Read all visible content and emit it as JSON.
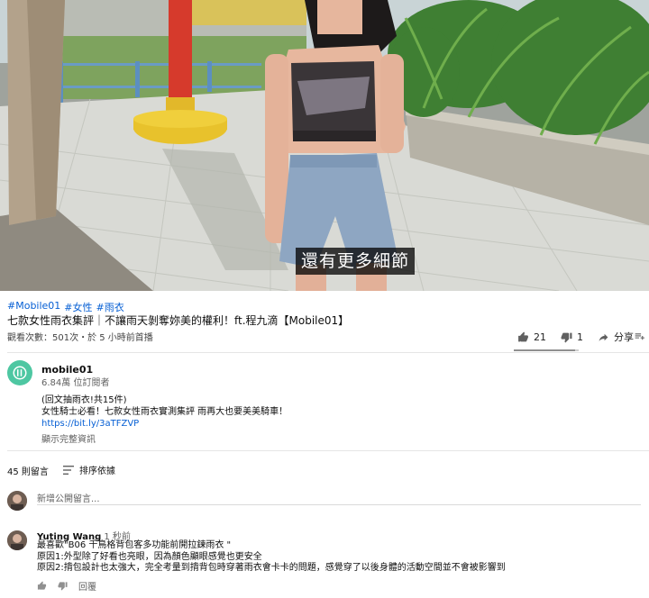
{
  "video": {
    "subtitle": "還有更多細節"
  },
  "hashtags": [
    "#Mobile01",
    "#女性",
    "#雨衣"
  ],
  "title": "七款女性雨衣集評｜不讓雨天剝奪妳美的權利！ft.程九滴【Mobile01】",
  "views": "觀看次數：501次・於 5 小時前首播",
  "actions": {
    "like_count": "21",
    "dislike_count": "1",
    "share_label": "分享"
  },
  "ratio": {
    "like_fraction": 0.94
  },
  "channel": {
    "name": "mobile01",
    "subscribers": "6.84萬 位訂閱者",
    "desc_line1": "(回文抽雨衣!共15件)",
    "desc_line2": "女性騎士必看！七款女性雨衣實測集評 雨再大也要美美騎車！",
    "desc_link": "https://bit.ly/3aTFZVP",
    "show_more": "顯示完整資訊"
  },
  "comments": {
    "count": "45 則留言",
    "sort_label": "排序依據",
    "add_placeholder": "新增公開留言...",
    "items": [
      {
        "author": "Yuting Wang",
        "time": "1 秒前",
        "line1": "最喜歡\"B06 千鳥格背包客多功能前開拉鍊雨衣 \"",
        "line2": "原因1:外型除了好看也亮眼，因為顏色顯眼感覺也更安全",
        "line3": "原因2:揹包設計也太強大，完全考量到揹背包時穿著雨衣會卡卡的問題，感覺穿了以後身體的活動空間並不會被影響到",
        "reply_label": "回覆"
      }
    ]
  },
  "colors": {
    "link": "#065fd4",
    "channel_avatar": "#4ec7a2"
  },
  "icons": [
    "thumb-up-icon",
    "thumb-down-icon",
    "share-icon",
    "add-to-playlist-icon",
    "sort-icon",
    "channel-logo-icon"
  ]
}
